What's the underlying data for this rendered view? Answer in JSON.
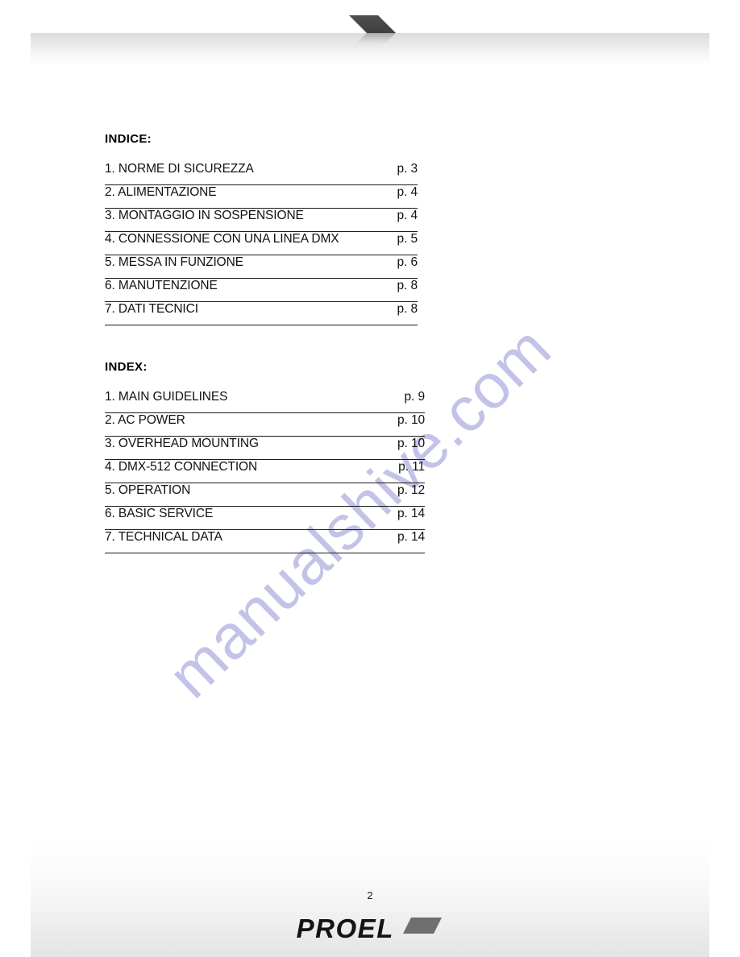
{
  "document": {
    "page_number": "2",
    "watermark": "manualshive.com",
    "brand": "PROEL",
    "accent_color": "#4a4a4a",
    "watermark_color": "#c3c3e8"
  },
  "header": {
    "arrow_icon": "right-chevron-icon"
  },
  "sections": [
    {
      "id": "italian",
      "heading": "INDICE:",
      "entries": [
        {
          "title": "1. NORME DI SICUREZZA",
          "page": "p. 3"
        },
        {
          "title": "2. ALIMENTAZIONE",
          "page": "p. 4"
        },
        {
          "title": "3. MONTAGGIO IN SOSPENSIONE",
          "page": "p. 4"
        },
        {
          "title": "4. CONNESSIONE CON UNA LINEA DMX",
          "page": "p. 5"
        },
        {
          "title": "5. MESSA IN FUNZIONE",
          "page": "p. 6"
        },
        {
          "title": "6. MANUTENZIONE",
          "page": "p. 8"
        },
        {
          "title": "7. DATI TECNICI",
          "page": "p. 8"
        }
      ]
    },
    {
      "id": "english",
      "heading": "INDEX:",
      "entries": [
        {
          "title": "1. MAIN GUIDELINES",
          "page": "p. 9"
        },
        {
          "title": "2. AC POWER",
          "page": "p. 10"
        },
        {
          "title": "3. OVERHEAD MOUNTING",
          "page": "p. 10"
        },
        {
          "title": "4. DMX-512 CONNECTION",
          "page": "p. 11"
        },
        {
          "title": "5. OPERATION",
          "page": "p. 12"
        },
        {
          "title": "6. BASIC SERVICE",
          "page": "p. 14"
        },
        {
          "title": "7. TECHNICAL DATA",
          "page": "p. 14"
        }
      ]
    }
  ],
  "footer": {
    "logo_mark": "parallelogram-mark-icon"
  }
}
